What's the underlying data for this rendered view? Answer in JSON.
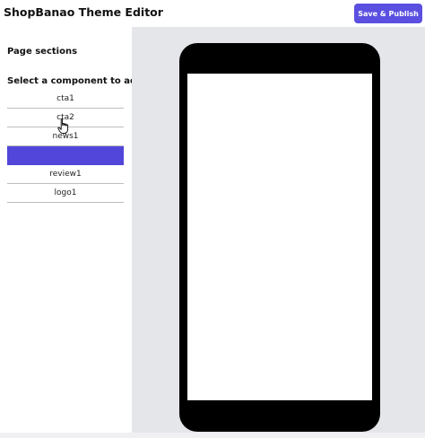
{
  "header": {
    "title": "ShopBanao Theme Editor",
    "publish_label": "Save & Publish"
  },
  "sidebar": {
    "sections_heading": "Page sections",
    "select_heading": "Select a component to add",
    "components": [
      {
        "label": "cta1"
      },
      {
        "label": "cta2"
      },
      {
        "label": "news1"
      },
      {
        "label": "",
        "selected": true
      },
      {
        "label": "review1"
      },
      {
        "label": "logo1"
      }
    ]
  },
  "colors": {
    "accent": "#5a4fe0",
    "canvas_bg": "#e5e6ea",
    "phone_frame": "#000000"
  },
  "icons": {
    "cursor": "hand-pointer-icon"
  }
}
